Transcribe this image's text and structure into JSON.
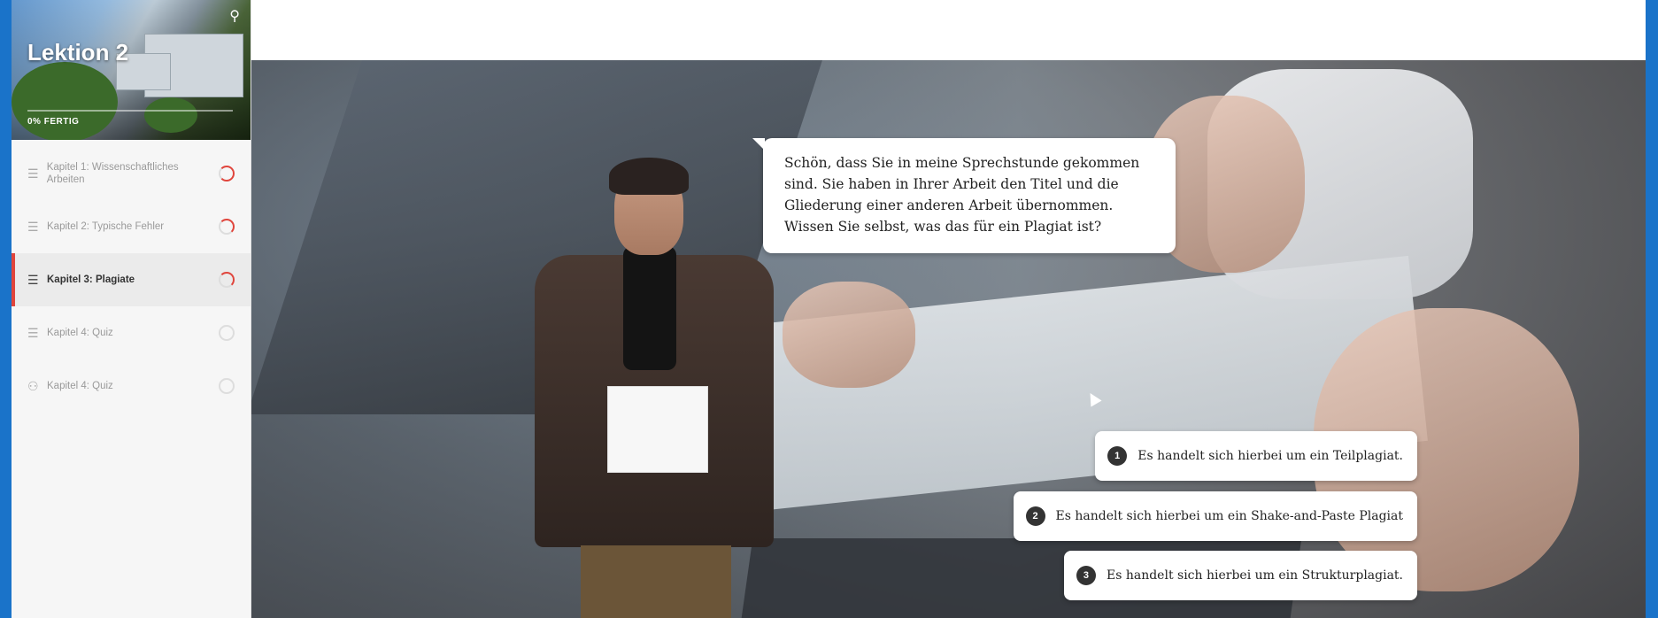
{
  "lesson": {
    "title": "Lektion 2",
    "progress_text": "0% FERTIG",
    "progress": 0
  },
  "sidebar": {
    "items": [
      {
        "label": "Kapitel 1: Wissenschaftliches Arbeiten",
        "icon": "lines-icon",
        "status": "in-progress"
      },
      {
        "label": "Kapitel 2: Typische Fehler",
        "icon": "lines-icon",
        "status": "in-progress"
      },
      {
        "label": "Kapitel 3: Plagiate",
        "icon": "lines-icon",
        "status": "in-progress",
        "active": true
      },
      {
        "label": "Kapitel 4: Quiz",
        "icon": "lines-icon",
        "status": "not-started"
      },
      {
        "label": "Kapitel 4: Quiz",
        "icon": "people-icon",
        "status": "not-started"
      }
    ]
  },
  "scene": {
    "speech": "Schön, dass Sie in meine Sprechstunde gekommen sind. Sie haben in Ihrer Arbeit den Titel und die Gliederung einer anderen Arbeit übernommen. Wissen Sie selbst, was das für ein Plagiat ist?",
    "answers": [
      {
        "num": "1",
        "text": "Es handelt sich hierbei um ein Teilplagiat."
      },
      {
        "num": "2",
        "text": "Es handelt sich hierbei um ein Shake-and-Paste Plagiat"
      },
      {
        "num": "3",
        "text": "Es handelt sich hierbei um ein Strukturplagiat."
      }
    ]
  },
  "colors": {
    "accent": "#e0453c",
    "frame": "#1a73c9"
  }
}
